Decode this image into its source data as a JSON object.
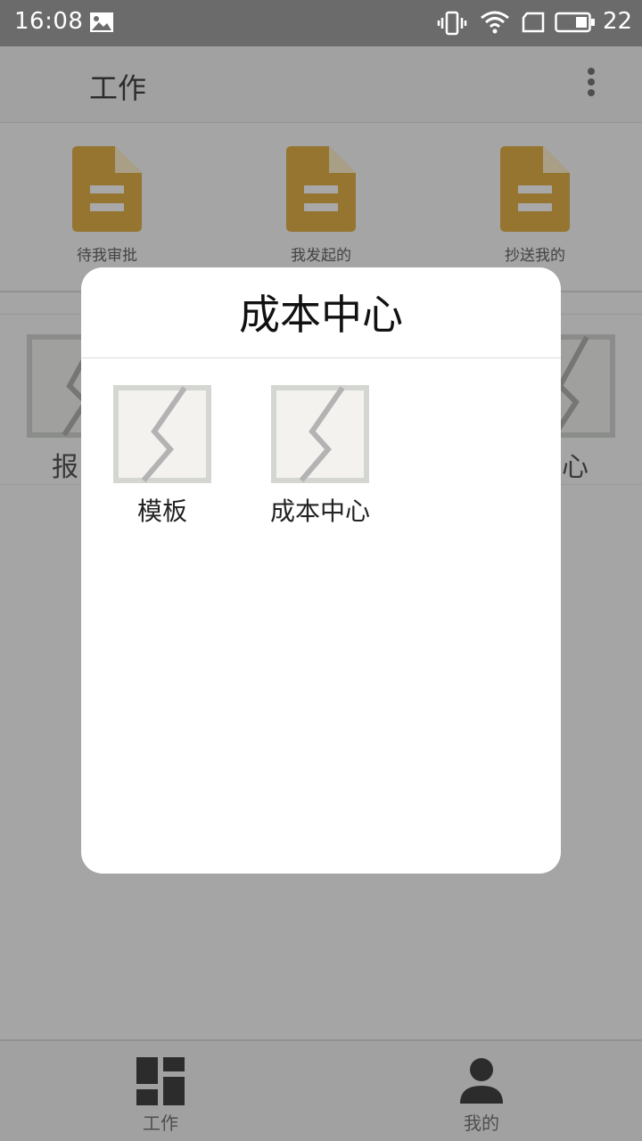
{
  "status_bar": {
    "time": "16:08",
    "battery_level": "22",
    "icons": [
      "gallery-icon",
      "vibrate-icon",
      "wifi-icon",
      "sim-card-icon",
      "battery-icon"
    ]
  },
  "header": {
    "title": "工作",
    "menu_icon": "more-vertical-icon"
  },
  "approvals": [
    {
      "label": "待我审批",
      "icon": "document-icon"
    },
    {
      "label": "我发起的",
      "icon": "document-icon"
    },
    {
      "label": "抄送我的",
      "icon": "document-icon"
    }
  ],
  "modules_behind": {
    "left_label": "报",
    "right_label": "中心"
  },
  "dialog": {
    "title": "成本中心",
    "items": [
      {
        "label": "模板",
        "icon": "broken-image-icon"
      },
      {
        "label": "成本中心",
        "icon": "broken-image-icon"
      }
    ]
  },
  "bottom_nav": [
    {
      "label": "工作",
      "icon": "dashboard-icon"
    },
    {
      "label": "我的",
      "icon": "person-icon"
    }
  ],
  "colors": {
    "status_bar": "#6b6b6b",
    "document_icon": "#e3b24a",
    "overlay": "rgba(0,0,0,0.34)",
    "dialog_bg": "#ffffff"
  }
}
